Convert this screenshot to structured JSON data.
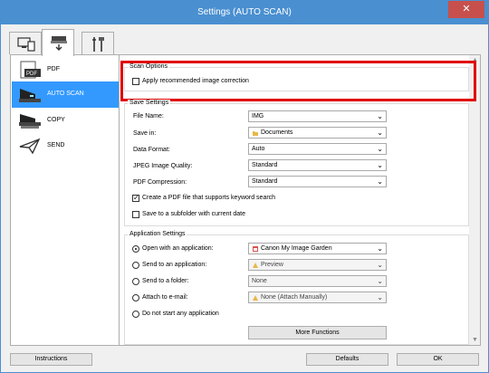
{
  "window": {
    "title": "Settings (AUTO SCAN)",
    "close_glyph": "✕"
  },
  "tabs": [
    {
      "icon": "scan-from-computer-icon"
    },
    {
      "icon": "scan-from-panel-icon",
      "active": true
    },
    {
      "icon": "general-settings-icon"
    }
  ],
  "sidebar": {
    "items": [
      {
        "label": "PDF",
        "icon": "pdf-icon"
      },
      {
        "label": "AUTO SCAN",
        "icon": "auto-scan-icon",
        "active": true
      },
      {
        "label": "COPY",
        "icon": "copy-icon"
      },
      {
        "label": "SEND",
        "icon": "send-icon"
      }
    ]
  },
  "scan_options": {
    "title": "Scan Options",
    "apply_correction_label": "Apply recommended image correction",
    "apply_correction_checked": false
  },
  "save_settings": {
    "title": "Save Settings",
    "file_name_label": "File Name:",
    "file_name_value": "IMG",
    "save_in_label": "Save in:",
    "save_in_value": "Documents",
    "data_format_label": "Data Format:",
    "data_format_value": "Auto",
    "jpeg_quality_label": "JPEG Image Quality:",
    "jpeg_quality_value": "Standard",
    "pdf_compression_label": "PDF Compression:",
    "pdf_compression_value": "Standard",
    "keyword_pdf_label": "Create a PDF file that supports keyword search",
    "keyword_pdf_checked": true,
    "subfolder_label": "Save to a subfolder with current date",
    "subfolder_checked": false
  },
  "application_settings": {
    "title": "Application Settings",
    "open_with_label": "Open with an application:",
    "open_with_value": "Canon My Image Garden",
    "send_to_app_label": "Send to an application:",
    "send_to_app_value": "Preview",
    "send_to_folder_label": "Send to a folder:",
    "send_to_folder_value": "None",
    "attach_email_label": "Attach to e-mail:",
    "attach_email_value": "None (Attach Manually)",
    "do_not_start_label": "Do not start any application",
    "selected": "open_with",
    "more_functions_label": "More Functions"
  },
  "footer": {
    "instructions_label": "Instructions",
    "defaults_label": "Defaults",
    "ok_label": "OK"
  },
  "colors": {
    "accent": "#3399ff",
    "titlebar": "#4a8fd0",
    "highlight_border": "#e00000"
  }
}
